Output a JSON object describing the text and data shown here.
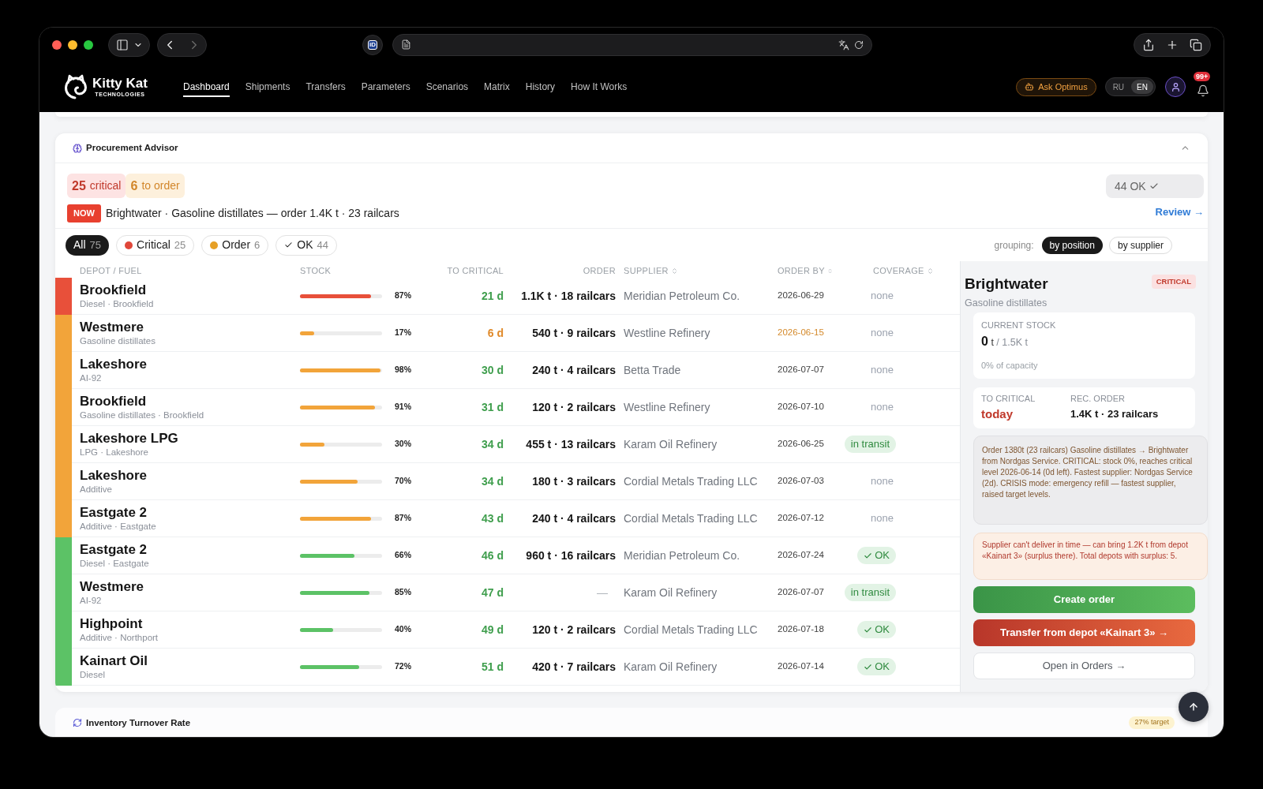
{
  "browser": {
    "extension_label": "iD"
  },
  "app_nav": {
    "logo": {
      "name": "Kitty Kat",
      "tagline": "TECHNOLOGIES"
    },
    "items": [
      {
        "label": "Dashboard",
        "selected": true
      },
      {
        "label": "Shipments",
        "selected": false
      },
      {
        "label": "Transfers",
        "selected": false
      },
      {
        "label": "Parameters",
        "selected": false
      },
      {
        "label": "Scenarios",
        "selected": false
      },
      {
        "label": "Matrix",
        "selected": false
      },
      {
        "label": "History",
        "selected": false
      },
      {
        "label": "How It Works",
        "selected": false
      }
    ],
    "assistant_button": "Ask Optimus",
    "languages": [
      {
        "label": "RU",
        "selected": false
      },
      {
        "label": "EN",
        "selected": true
      }
    ],
    "notifications_badge": "99+"
  },
  "advisor": {
    "title": "Procurement Advisor",
    "expanded": true,
    "summary": [
      {
        "kind": "critical",
        "count": "25",
        "label": "critical"
      },
      {
        "kind": "order",
        "count": "6",
        "label": "to order"
      }
    ],
    "ok_summary": {
      "count": "44",
      "label": "OK"
    },
    "now": {
      "badge": "NOW",
      "text": "Brightwater · Gasoline distillates — order 1.4K t · 23 railcars"
    },
    "review_link": "Review →",
    "filters": [
      {
        "kind": "plain",
        "label": "All",
        "count": "75",
        "selected": true
      },
      {
        "kind": "dot",
        "label": "Critical",
        "count": "25",
        "selected": false,
        "color": "#e0473a"
      },
      {
        "kind": "dot",
        "label": "Order",
        "count": "6",
        "selected": false,
        "color": "#e6a026"
      },
      {
        "kind": "check",
        "label": "OK",
        "count": "44",
        "selected": false
      }
    ],
    "grouping": {
      "label": "grouping:",
      "options": [
        {
          "label": "by position",
          "selected": true
        },
        {
          "label": "by supplier",
          "selected": false
        }
      ]
    },
    "table": {
      "columns": [
        {
          "label": "DEPOT / FUEL",
          "sortable": false
        },
        {
          "label": "STOCK",
          "sortable": false
        },
        {
          "label": "TO CRITICAL",
          "sortable": false
        },
        {
          "label": "ORDER",
          "sortable": false
        },
        {
          "label": "SUPPLIER",
          "sortable": true
        },
        {
          "label": "ORDER BY",
          "sortable": true
        },
        {
          "label": "COVERAGE",
          "sortable": true
        }
      ],
      "rows": [
        {
          "depot": "Brookfield",
          "fuel": "Diesel · Brookfield",
          "color": "#e8503a",
          "level": 0.87,
          "stock": "87%",
          "to_critical": "21 d",
          "warning": false,
          "has_order": true,
          "order": "1.1K t · 18 railcars",
          "supplier": "Meridian Petroleum Co.",
          "order_by": "2026-06-29",
          "coverage": {
            "kind": "none",
            "label": "none"
          }
        },
        {
          "depot": "Westmere",
          "fuel": "Gasoline distillates",
          "color": "#f2a43a",
          "level": 0.17,
          "stock": "17%",
          "to_critical": "6 d",
          "warning": true,
          "has_order": true,
          "order": "540 t · 9 railcars",
          "supplier": "Westline Refinery",
          "order_by": "2026-06-15",
          "coverage": {
            "kind": "none",
            "label": "none"
          }
        },
        {
          "depot": "Lakeshore",
          "fuel": "AI-92",
          "color": "#f2a43a",
          "level": 0.98,
          "stock": "98%",
          "to_critical": "30 d",
          "warning": false,
          "has_order": true,
          "order": "240 t · 4 railcars",
          "supplier": "Betta Trade",
          "order_by": "2026-07-07",
          "coverage": {
            "kind": "none",
            "label": "none"
          }
        },
        {
          "depot": "Brookfield",
          "fuel": "Gasoline distillates · Brookfield",
          "color": "#f2a43a",
          "level": 0.91,
          "stock": "91%",
          "to_critical": "31 d",
          "warning": false,
          "has_order": true,
          "order": "120 t · 2 railcars",
          "supplier": "Westline Refinery",
          "order_by": "2026-07-10",
          "coverage": {
            "kind": "none",
            "label": "none"
          }
        },
        {
          "depot": "Lakeshore LPG",
          "fuel": "LPG · Lakeshore",
          "color": "#f2a43a",
          "level": 0.3,
          "stock": "30%",
          "to_critical": "34 d",
          "warning": false,
          "has_order": true,
          "order": "455 t · 13 railcars",
          "supplier": "Karam Oil Refinery",
          "order_by": "2026-06-25",
          "coverage": {
            "kind": "transit",
            "label": "in transit"
          }
        },
        {
          "depot": "Lakeshore",
          "fuel": "Additive",
          "color": "#f2a43a",
          "level": 0.7,
          "stock": "70%",
          "to_critical": "34 d",
          "warning": false,
          "has_order": true,
          "order": "180 t · 3 railcars",
          "supplier": "Cordial Metals Trading LLC",
          "order_by": "2026-07-03",
          "coverage": {
            "kind": "none",
            "label": "none"
          }
        },
        {
          "depot": "Eastgate 2",
          "fuel": "Additive · Eastgate",
          "color": "#f2a43a",
          "level": 0.87,
          "stock": "87%",
          "to_critical": "43 d",
          "warning": false,
          "has_order": true,
          "order": "240 t · 4 railcars",
          "supplier": "Cordial Metals Trading LLC",
          "order_by": "2026-07-12",
          "coverage": {
            "kind": "none",
            "label": "none"
          }
        },
        {
          "depot": "Eastgate 2",
          "fuel": "Diesel · Eastgate",
          "color": "#5cc266",
          "level": 0.66,
          "stock": "66%",
          "to_critical": "46 d",
          "warning": false,
          "has_order": true,
          "order": "960 t · 16 railcars",
          "supplier": "Meridian Petroleum Co.",
          "order_by": "2026-07-24",
          "coverage": {
            "kind": "ok",
            "label": "OK"
          }
        },
        {
          "depot": "Westmere",
          "fuel": "AI-92",
          "color": "#5cc266",
          "level": 0.85,
          "stock": "85%",
          "to_critical": "47 d",
          "warning": false,
          "has_order": false,
          "order": "—",
          "supplier": "Karam Oil Refinery",
          "order_by": "2026-07-07",
          "coverage": {
            "kind": "transit",
            "label": "in transit"
          }
        },
        {
          "depot": "Highpoint",
          "fuel": "Additive · Northport",
          "color": "#5cc266",
          "level": 0.4,
          "stock": "40%",
          "to_critical": "49 d",
          "warning": false,
          "has_order": true,
          "order": "120 t · 2 railcars",
          "supplier": "Cordial Metals Trading LLC",
          "order_by": "2026-07-18",
          "coverage": {
            "kind": "ok",
            "label": "OK"
          }
        },
        {
          "depot": "Kainart Oil",
          "fuel": "Diesel",
          "color": "#5cc266",
          "level": 0.72,
          "stock": "72%",
          "to_critical": "51 d",
          "warning": false,
          "has_order": true,
          "order": "420 t · 7 railcars",
          "supplier": "Karam Oil Refinery",
          "order_by": "2026-07-14",
          "coverage": {
            "kind": "ok",
            "label": "OK"
          }
        }
      ]
    },
    "detail": {
      "title": "Brightwater",
      "status": "CRITICAL",
      "subtitle": "Gasoline distillates",
      "current_stock": {
        "label": "CURRENT STOCK",
        "value": "0",
        "unit": "t",
        "capacity": "/ 1.5K t",
        "note": "0% of capacity"
      },
      "to_critical": {
        "label": "TO CRITICAL",
        "value": "today"
      },
      "rec_order": {
        "label": "REC. ORDER",
        "value": "1.4K t · 23 railcars"
      },
      "explanation": "Order 1380t (23 railcars) Gasoline distillates → Brightwater from Nordgas Service. CRITICAL: stock 0%, reaches critical level 2026-06-14 (0d left). Fastest supplier: Nordgas Service (2d). CRISIS mode: emergency refill — fastest supplier, raised target levels.",
      "alert": "Supplier can't deliver in time — can bring 1.2K t from depot «Kainart 3» (surplus there). Total depots with surplus: 5.",
      "actions": [
        {
          "kind": "create",
          "label": "Create order"
        },
        {
          "kind": "transfer",
          "label": "Transfer from depot «Kainart 3» →"
        },
        {
          "kind": "open",
          "label": "Open in Orders →"
        }
      ]
    }
  },
  "turnover": {
    "title": "Inventory Turnover Rate",
    "badge": "27% target"
  }
}
